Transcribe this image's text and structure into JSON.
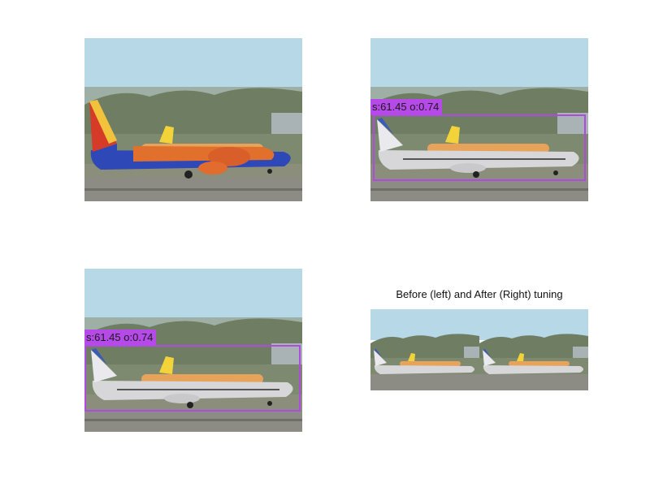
{
  "figure": {
    "panels": [
      {
        "name": "original-image",
        "livery": "southwest",
        "detection": null
      },
      {
        "name": "detection-result-1",
        "livery": "white",
        "detection": {
          "label": "s:61.45 o:0.74",
          "color": "#b54ae8"
        }
      },
      {
        "name": "detection-result-2",
        "livery": "white",
        "detection": {
          "label": "s:61.45 o:0.74",
          "color": "#b54ae8"
        }
      },
      {
        "name": "before-after-comparison",
        "livery": "white-pair",
        "detection": null
      }
    ],
    "comparison_title": "Before (left) and After (Right) tuning"
  },
  "colors": {
    "sky": "#b6d7e6",
    "hills": "#6f7d62",
    "runway": "#8c8b84",
    "box": "#b04be0"
  }
}
